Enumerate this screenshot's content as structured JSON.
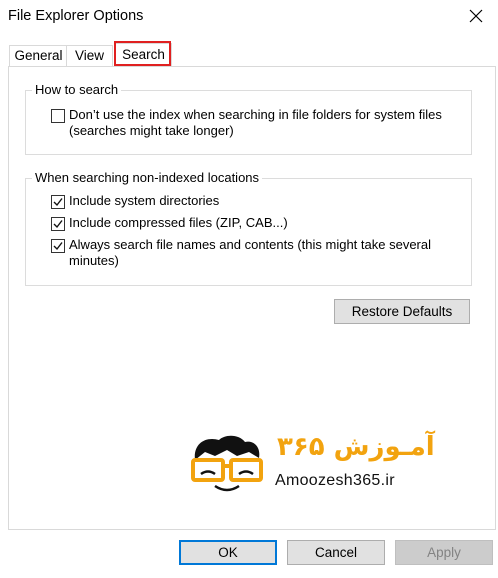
{
  "window": {
    "title": "File Explorer Options"
  },
  "tabs": [
    {
      "label": "General",
      "active": false
    },
    {
      "label": "View",
      "active": false
    },
    {
      "label": "Search",
      "active": true
    }
  ],
  "how_to_search": {
    "legend": "How to search",
    "options": [
      {
        "label_line1": "Don’t use the index when searching in file folders for system files",
        "label_line2": "(searches might take longer)",
        "checked": false
      }
    ]
  },
  "non_indexed": {
    "legend": "When searching non-indexed locations",
    "options": [
      {
        "label_line1": "Include system directories",
        "checked": true
      },
      {
        "label_line1": "Include compressed files (ZIP, CAB...)",
        "checked": true
      },
      {
        "label_line1": "Always search file names and contents (this might take several",
        "label_line2": "minutes)",
        "checked": true
      }
    ]
  },
  "buttons": {
    "restore_defaults": "Restore Defaults",
    "ok": "OK",
    "cancel": "Cancel",
    "apply": "Apply"
  },
  "watermark": {
    "text_fa": "آمـوزش ۳۶۵",
    "text_en": "Amoozesh365.ir"
  },
  "colors": {
    "highlight_red": "#e02020",
    "focus_blue": "#0078d7",
    "logo_orange": "#f2a30f"
  },
  "icons": [
    "close-icon",
    "checkmark-icon",
    "logo-face-icon"
  ]
}
